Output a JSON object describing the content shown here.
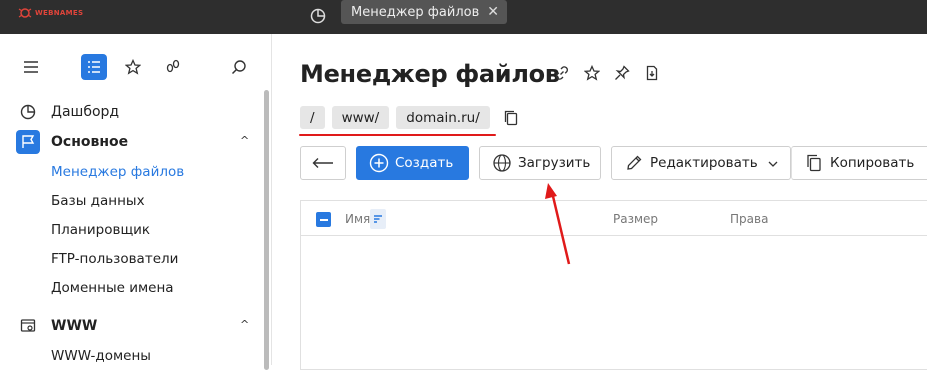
{
  "topbar": {
    "logo_text": "WEBNAMES",
    "tab_label": "Менеджер файлов",
    "tab_close": "✕"
  },
  "sidebar": {
    "items": [
      {
        "label": "Дашборд"
      },
      {
        "label": "Основное"
      },
      {
        "label": "WWW"
      }
    ],
    "sub_main": [
      "Менеджер файлов",
      "Базы данных",
      "Планировщик",
      "FTP-пользователи",
      "Доменные имена"
    ],
    "sub_www": [
      "WWW-домены"
    ],
    "caret": "^"
  },
  "main": {
    "title": "Менеджер файлов",
    "breadcrumbs": [
      "/",
      "www/",
      "domain.ru/"
    ],
    "toolbar": {
      "create_label": "Создать",
      "upload_label": "Загрузить",
      "edit_label": "Редактировать",
      "copy_label": "Копировать"
    },
    "table": {
      "headers": {
        "name": "Имя",
        "size": "Размер",
        "perms": "Права"
      }
    }
  },
  "colors": {
    "accent": "#2879e0",
    "annotation": "#e01a1a"
  }
}
